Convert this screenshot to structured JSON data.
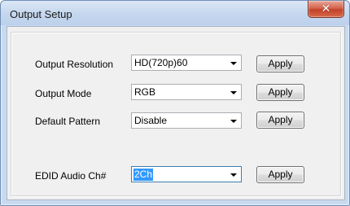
{
  "window": {
    "title": "Output Setup",
    "close_icon": "close-icon"
  },
  "rows": [
    {
      "label": "Output Resolution",
      "value": "HD(720p)60",
      "button": "Apply"
    },
    {
      "label": "Output Mode",
      "value": "RGB",
      "button": "Apply"
    },
    {
      "label": "Default Pattern",
      "value": "Disable",
      "button": "Apply"
    },
    {
      "label": "EDID Audio Ch#",
      "value": "2Ch",
      "button": "Apply"
    }
  ],
  "colors": {
    "close_button": "#c7432b",
    "selection": "#3399ff",
    "titlebar": "#c5d7ee"
  }
}
